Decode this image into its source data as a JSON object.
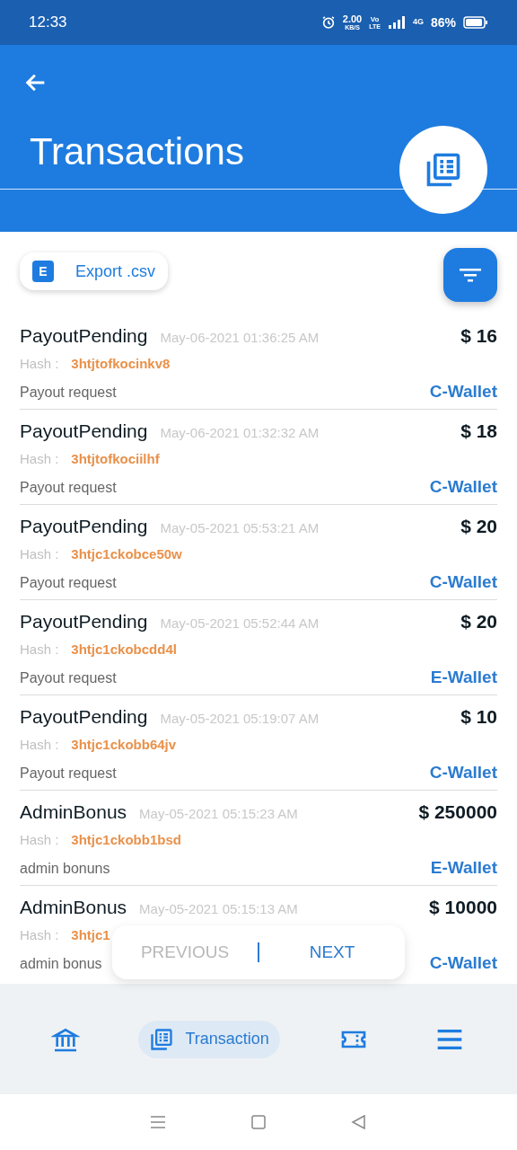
{
  "status_bar": {
    "time": "12:33",
    "speed": "2.00",
    "speed_unit": "KB/S",
    "volte_top": "Vo",
    "volte_bottom": "LTE",
    "network": "4G",
    "battery": "86%"
  },
  "header": {
    "title": "Transactions"
  },
  "toolbar": {
    "export_badge": "E",
    "export_label": "Export .csv"
  },
  "transactions": [
    {
      "title": "PayoutPending",
      "date": "May-06-2021 01:36:25 AM",
      "hash_label": "Hash :",
      "hash": "3htjtofkocinkv8",
      "description": "Payout request",
      "amount": "$ 16",
      "wallet": "C-Wallet"
    },
    {
      "title": "PayoutPending",
      "date": "May-06-2021 01:32:32 AM",
      "hash_label": "Hash :",
      "hash": "3htjtofkociilhf",
      "description": "Payout request",
      "amount": "$ 18",
      "wallet": "C-Wallet"
    },
    {
      "title": "PayoutPending",
      "date": "May-05-2021 05:53:21 AM",
      "hash_label": "Hash :",
      "hash": "3htjc1ckobce50w",
      "description": "Payout request",
      "amount": "$ 20",
      "wallet": "C-Wallet"
    },
    {
      "title": "PayoutPending",
      "date": "May-05-2021 05:52:44 AM",
      "hash_label": "Hash :",
      "hash": "3htjc1ckobcdd4l",
      "description": "Payout request",
      "amount": "$ 20",
      "wallet": "E-Wallet"
    },
    {
      "title": "PayoutPending",
      "date": "May-05-2021 05:19:07 AM",
      "hash_label": "Hash :",
      "hash": "3htjc1ckobb64jv",
      "description": "Payout request",
      "amount": "$ 10",
      "wallet": "C-Wallet"
    },
    {
      "title": "AdminBonus",
      "date": "May-05-2021 05:15:23 AM",
      "hash_label": "Hash :",
      "hash": "3htjc1ckobb1bsd",
      "description": "admin bonuns",
      "amount": "$ 250000",
      "wallet": "E-Wallet"
    },
    {
      "title": "AdminBonus",
      "date": "May-05-2021 05:15:13 AM",
      "hash_label": "Hash :",
      "hash": "3htjc1",
      "description": "admin bonus",
      "amount": "$ 10000",
      "wallet": "C-Wallet"
    }
  ],
  "pagination": {
    "previous": {
      "label": "PREVIOUS",
      "disabled": true
    },
    "next": {
      "label": "NEXT",
      "disabled": false
    }
  },
  "bottom_nav": [
    {
      "kind": "bank",
      "selected": false
    },
    {
      "kind": "transactions",
      "label": "Transaction",
      "selected": true
    },
    {
      "kind": "ticket",
      "selected": false
    },
    {
      "kind": "menu",
      "selected": false
    }
  ]
}
